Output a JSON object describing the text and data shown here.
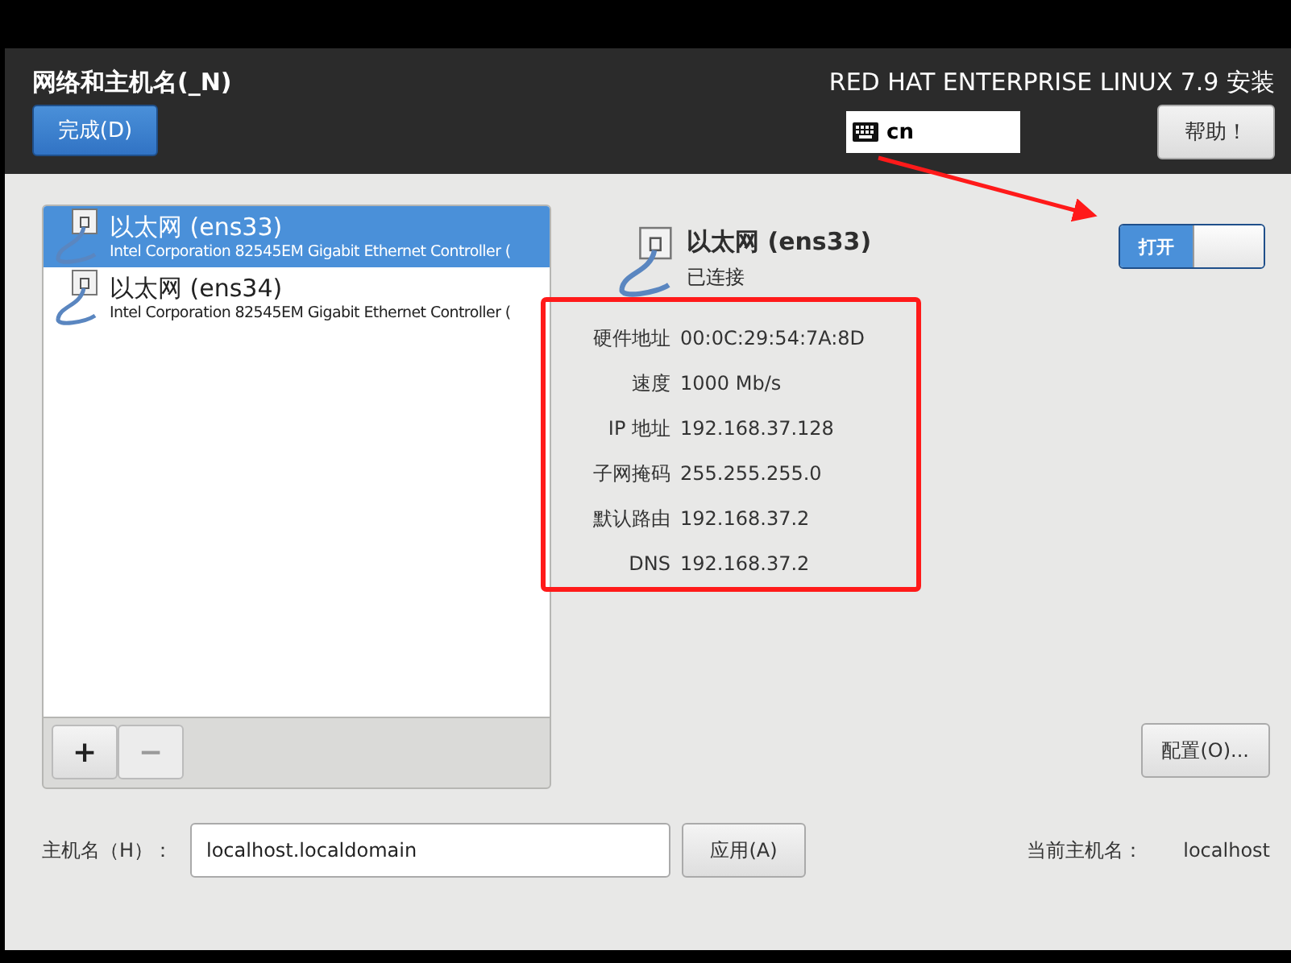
{
  "window": {
    "title": "网络和主机名(_N)",
    "product": "RED HAT ENTERPRISE LINUX 7.9 安装"
  },
  "header": {
    "done_button": "完成(D)",
    "keyboard_layout": "cn",
    "help_button": "帮助！"
  },
  "devices": [
    {
      "name": "以太网 (ens33)",
      "description": "Intel Corporation 82545EM Gigabit Ethernet Controller (",
      "selected": true
    },
    {
      "name": "以太网 (ens34)",
      "description": "Intel Corporation 82545EM Gigabit Ethernet Controller (",
      "selected": false
    }
  ],
  "device_buttons": [
    {
      "label": "+",
      "disabled": false
    },
    {
      "label": "−",
      "disabled": true
    }
  ],
  "detail": {
    "name": "以太网 (ens33)",
    "status": "已连接",
    "switch": {
      "label": "打开",
      "on": true
    },
    "properties": [
      {
        "label": "硬件地址",
        "value": "00:0C:29:54:7A:8D"
      },
      {
        "label": "速度",
        "value": "1000 Mb/s"
      },
      {
        "label": "IP 地址",
        "value": "192.168.37.128"
      },
      {
        "label": "子网掩码",
        "value": "255.255.255.0"
      },
      {
        "label": "默认路由",
        "value": "192.168.37.2"
      },
      {
        "label": "DNS",
        "value": "192.168.37.2"
      }
    ],
    "configure_button": "配置(O)..."
  },
  "hostname": {
    "label": "主机名（H）：",
    "value": "localhost.localdomain",
    "apply_button": "应用(A)",
    "current_label": "当前主机名：",
    "current_value": "localhost"
  }
}
